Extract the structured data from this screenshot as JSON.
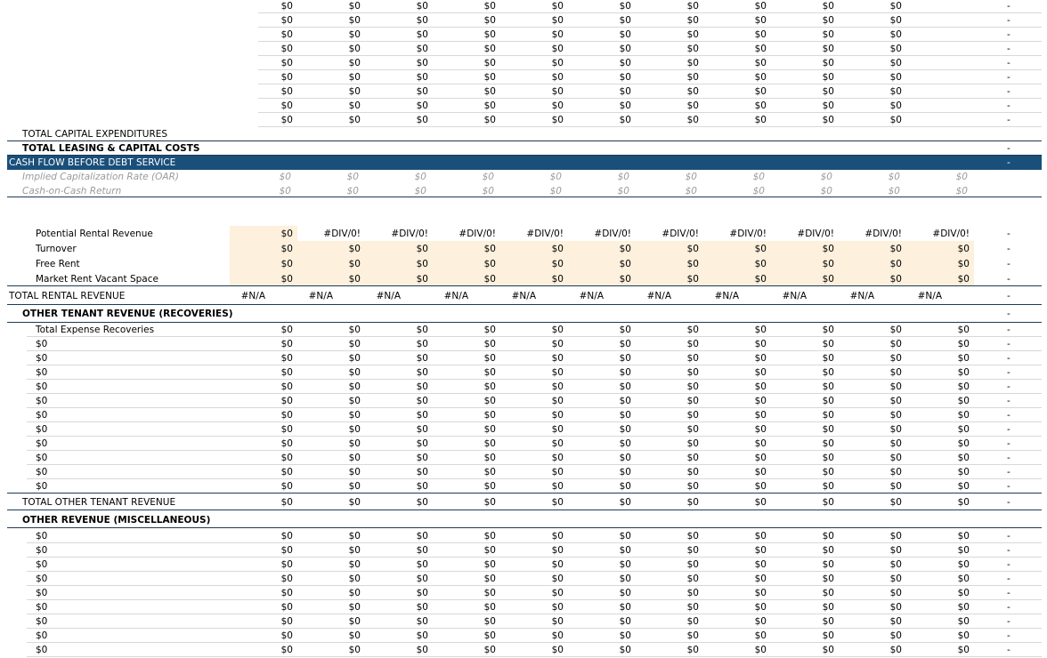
{
  "dash": "-",
  "top_zero_rows": [
    [
      "$0",
      "$0",
      "$0",
      "$0",
      "$0",
      "$0",
      "$0",
      "$0",
      "$0",
      "$0"
    ],
    [
      "$0",
      "$0",
      "$0",
      "$0",
      "$0",
      "$0",
      "$0",
      "$0",
      "$0",
      "$0"
    ],
    [
      "$0",
      "$0",
      "$0",
      "$0",
      "$0",
      "$0",
      "$0",
      "$0",
      "$0",
      "$0"
    ],
    [
      "$0",
      "$0",
      "$0",
      "$0",
      "$0",
      "$0",
      "$0",
      "$0",
      "$0",
      "$0"
    ],
    [
      "$0",
      "$0",
      "$0",
      "$0",
      "$0",
      "$0",
      "$0",
      "$0",
      "$0",
      "$0"
    ],
    [
      "$0",
      "$0",
      "$0",
      "$0",
      "$0",
      "$0",
      "$0",
      "$0",
      "$0",
      "$0"
    ],
    [
      "$0",
      "$0",
      "$0",
      "$0",
      "$0",
      "$0",
      "$0",
      "$0",
      "$0",
      "$0"
    ],
    [
      "$0",
      "$0",
      "$0",
      "$0",
      "$0",
      "$0",
      "$0",
      "$0",
      "$0",
      "$0"
    ],
    [
      "$0",
      "$0",
      "$0",
      "$0",
      "$0",
      "$0",
      "$0",
      "$0",
      "$0",
      "$0"
    ]
  ],
  "total_capex": {
    "label": "TOTAL CAPITAL EXPENDITURES"
  },
  "total_leasing": {
    "label": "TOTAL LEASING & CAPITAL COSTS",
    "dash": "-"
  },
  "cash_flow": {
    "label": "CASH FLOW BEFORE DEBT SERVICE",
    "dash": "-"
  },
  "oar": {
    "label": "Implied Capitalization Rate (OAR)",
    "values": [
      "$0",
      "$0",
      "$0",
      "$0",
      "$0",
      "$0",
      "$0",
      "$0",
      "$0",
      "$0",
      "$0"
    ]
  },
  "coc": {
    "label": "Cash-on-Cash Return",
    "values": [
      "$0",
      "$0",
      "$0",
      "$0",
      "$0",
      "$0",
      "$0",
      "$0",
      "$0",
      "$0",
      "$0"
    ]
  },
  "rental_rows": [
    {
      "label": "Potential Rental Revenue",
      "values": [
        "$0",
        "#DIV/0!",
        "#DIV/0!",
        "#DIV/0!",
        "#DIV/0!",
        "#DIV/0!",
        "#DIV/0!",
        "#DIV/0!",
        "#DIV/0!",
        "#DIV/0!",
        "#DIV/0!"
      ]
    },
    {
      "label": "Turnover",
      "values": [
        "$0",
        "$0",
        "$0",
        "$0",
        "$0",
        "$0",
        "$0",
        "$0",
        "$0",
        "$0",
        "$0"
      ]
    },
    {
      "label": "Free Rent",
      "values": [
        "$0",
        "$0",
        "$0",
        "$0",
        "$0",
        "$0",
        "$0",
        "$0",
        "$0",
        "$0",
        "$0"
      ]
    },
    {
      "label": "Market Rent Vacant Space",
      "values": [
        "$0",
        "$0",
        "$0",
        "$0",
        "$0",
        "$0",
        "$0",
        "$0",
        "$0",
        "$0",
        "$0"
      ]
    }
  ],
  "total_rental": {
    "label": "TOTAL RENTAL REVENUE",
    "values": [
      "#N/A",
      "#N/A",
      "#N/A",
      "#N/A",
      "#N/A",
      "#N/A",
      "#N/A",
      "#N/A",
      "#N/A",
      "#N/A",
      "#N/A"
    ]
  },
  "other_tenant_header": {
    "label": "OTHER TENANT REVENUE (RECOVERIES)"
  },
  "recovery_rows": [
    {
      "label": "Total Expense Recoveries",
      "values": [
        "$0",
        "$0",
        "$0",
        "$0",
        "$0",
        "$0",
        "$0",
        "$0",
        "$0",
        "$0",
        "$0"
      ]
    },
    {
      "label": "$0",
      "values": [
        "$0",
        "$0",
        "$0",
        "$0",
        "$0",
        "$0",
        "$0",
        "$0",
        "$0",
        "$0",
        "$0"
      ]
    },
    {
      "label": "$0",
      "values": [
        "$0",
        "$0",
        "$0",
        "$0",
        "$0",
        "$0",
        "$0",
        "$0",
        "$0",
        "$0",
        "$0"
      ]
    },
    {
      "label": "$0",
      "values": [
        "$0",
        "$0",
        "$0",
        "$0",
        "$0",
        "$0",
        "$0",
        "$0",
        "$0",
        "$0",
        "$0"
      ]
    },
    {
      "label": "$0",
      "values": [
        "$0",
        "$0",
        "$0",
        "$0",
        "$0",
        "$0",
        "$0",
        "$0",
        "$0",
        "$0",
        "$0"
      ]
    },
    {
      "label": "$0",
      "values": [
        "$0",
        "$0",
        "$0",
        "$0",
        "$0",
        "$0",
        "$0",
        "$0",
        "$0",
        "$0",
        "$0"
      ]
    },
    {
      "label": "$0",
      "values": [
        "$0",
        "$0",
        "$0",
        "$0",
        "$0",
        "$0",
        "$0",
        "$0",
        "$0",
        "$0",
        "$0"
      ]
    },
    {
      "label": "$0",
      "values": [
        "$0",
        "$0",
        "$0",
        "$0",
        "$0",
        "$0",
        "$0",
        "$0",
        "$0",
        "$0",
        "$0"
      ]
    },
    {
      "label": "$0",
      "values": [
        "$0",
        "$0",
        "$0",
        "$0",
        "$0",
        "$0",
        "$0",
        "$0",
        "$0",
        "$0",
        "$0"
      ]
    },
    {
      "label": "$0",
      "values": [
        "$0",
        "$0",
        "$0",
        "$0",
        "$0",
        "$0",
        "$0",
        "$0",
        "$0",
        "$0",
        "$0"
      ]
    },
    {
      "label": "$0",
      "values": [
        "$0",
        "$0",
        "$0",
        "$0",
        "$0",
        "$0",
        "$0",
        "$0",
        "$0",
        "$0",
        "$0"
      ]
    },
    {
      "label": "$0",
      "values": [
        "$0",
        "$0",
        "$0",
        "$0",
        "$0",
        "$0",
        "$0",
        "$0",
        "$0",
        "$0",
        "$0"
      ]
    }
  ],
  "total_other_tenant": {
    "label": "TOTAL OTHER TENANT REVENUE",
    "values": [
      "$0",
      "$0",
      "$0",
      "$0",
      "$0",
      "$0",
      "$0",
      "$0",
      "$0",
      "$0",
      "$0"
    ]
  },
  "other_revenue_header": {
    "label": "OTHER REVENUE (MISCELLANEOUS)"
  },
  "misc_rows": [
    {
      "label": "$0",
      "values": [
        "$0",
        "$0",
        "$0",
        "$0",
        "$0",
        "$0",
        "$0",
        "$0",
        "$0",
        "$0",
        "$0"
      ]
    },
    {
      "label": "$0",
      "values": [
        "$0",
        "$0",
        "$0",
        "$0",
        "$0",
        "$0",
        "$0",
        "$0",
        "$0",
        "$0",
        "$0"
      ]
    },
    {
      "label": "$0",
      "values": [
        "$0",
        "$0",
        "$0",
        "$0",
        "$0",
        "$0",
        "$0",
        "$0",
        "$0",
        "$0",
        "$0"
      ]
    },
    {
      "label": "$0",
      "values": [
        "$0",
        "$0",
        "$0",
        "$0",
        "$0",
        "$0",
        "$0",
        "$0",
        "$0",
        "$0",
        "$0"
      ]
    },
    {
      "label": "$0",
      "values": [
        "$0",
        "$0",
        "$0",
        "$0",
        "$0",
        "$0",
        "$0",
        "$0",
        "$0",
        "$0",
        "$0"
      ]
    },
    {
      "label": "$0",
      "values": [
        "$0",
        "$0",
        "$0",
        "$0",
        "$0",
        "$0",
        "$0",
        "$0",
        "$0",
        "$0",
        "$0"
      ]
    },
    {
      "label": "$0",
      "values": [
        "$0",
        "$0",
        "$0",
        "$0",
        "$0",
        "$0",
        "$0",
        "$0",
        "$0",
        "$0",
        "$0"
      ]
    },
    {
      "label": "$0",
      "values": [
        "$0",
        "$0",
        "$0",
        "$0",
        "$0",
        "$0",
        "$0",
        "$0",
        "$0",
        "$0",
        "$0"
      ]
    },
    {
      "label": "$0",
      "values": [
        "$0",
        "$0",
        "$0",
        "$0",
        "$0",
        "$0",
        "$0",
        "$0",
        "$0",
        "$0",
        "$0"
      ]
    }
  ]
}
